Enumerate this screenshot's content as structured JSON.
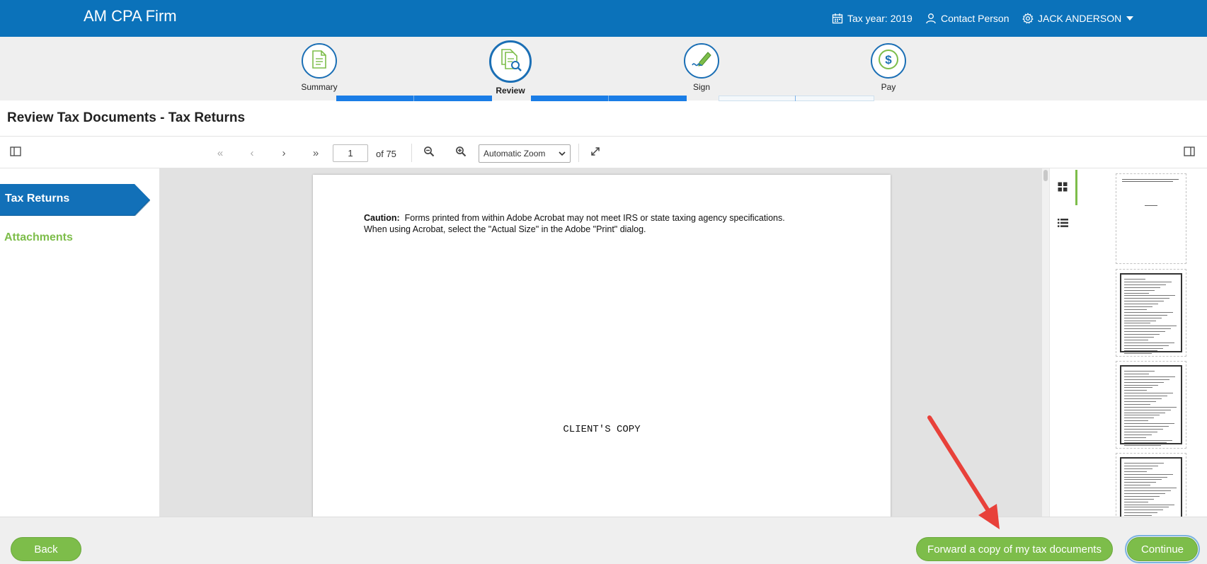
{
  "header": {
    "brand": "AM CPA Firm",
    "tax_year": "Tax year: 2019",
    "contact": "Contact Person",
    "user": "JACK ANDERSON",
    "bg_color": "#0b72ba"
  },
  "stepper": {
    "steps": [
      {
        "label": "Summary",
        "icon": "document-icon",
        "state": "complete"
      },
      {
        "label": "Review",
        "icon": "document-search-icon",
        "state": "current"
      },
      {
        "label": "Sign",
        "icon": "pen-signature-icon",
        "state": "upcoming"
      },
      {
        "label": "Pay",
        "icon": "dollar-icon",
        "state": "upcoming"
      }
    ],
    "progress": 0.67,
    "active_color": "#1a7de6"
  },
  "page": {
    "title": "Review Tax Documents - Tax Returns"
  },
  "toolbar": {
    "page_number": "1",
    "page_of": "of 75",
    "zoom": "Automatic Zoom"
  },
  "nav": {
    "active": "Tax Returns",
    "link": "Attachments",
    "active_color": "#1270b8",
    "link_color": "#7dbd4a"
  },
  "document": {
    "caution_label": "Caution:",
    "caution_line1": "Forms printed from within Adobe Acrobat may not meet IRS or state taxing agency specifications.",
    "caution_line2": "When using Acrobat, select the \"Actual Size\" in the Adobe \"Print\" dialog.",
    "center_text": "CLIENT'S COPY"
  },
  "footer": {
    "back": "Back",
    "forward": "Forward a copy of my tax documents",
    "continue": "Continue",
    "button_color": "#7dbd4a"
  },
  "annotation": {
    "arrow_color": "#e8413a"
  }
}
